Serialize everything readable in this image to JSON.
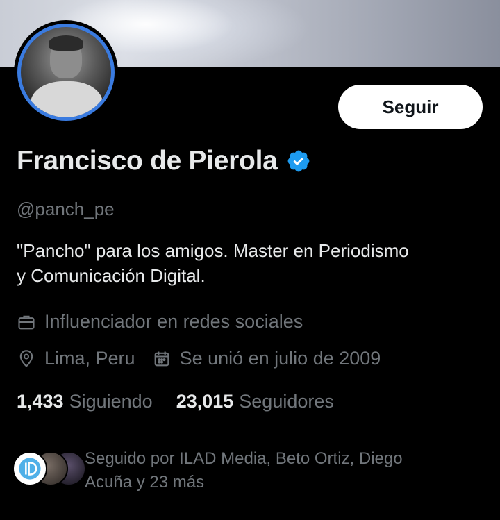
{
  "profile": {
    "name": "Francisco de Pierola",
    "handle": "@panch_pe",
    "bio_line1": "\"Pancho\" para los amigos. Master en Periodismo",
    "bio_line2": "y Comunicación Digital.",
    "category": "Influenciador en redes sociales",
    "location": "Lima, Peru",
    "joined": "Se unió en julio de 2009"
  },
  "actions": {
    "follow_label": "Seguir"
  },
  "stats": {
    "following_count": "1,433",
    "following_label": "Siguiendo",
    "followers_count": "23,015",
    "followers_label": "Seguidores"
  },
  "followed_by": {
    "line1": "Seguido por ILAD Media, Beto Ortiz, Diego",
    "line2": "Acuña y 23 más"
  },
  "icons": {
    "verified": "verified-badge-icon",
    "category": "briefcase-icon",
    "location": "location-pin-icon",
    "joined": "calendar-icon"
  },
  "colors": {
    "background": "#000000",
    "primary_text": "#e7e9ea",
    "secondary_text": "#71767b",
    "verified": "#1d9bf0",
    "follow_button_bg": "#ffffff"
  }
}
